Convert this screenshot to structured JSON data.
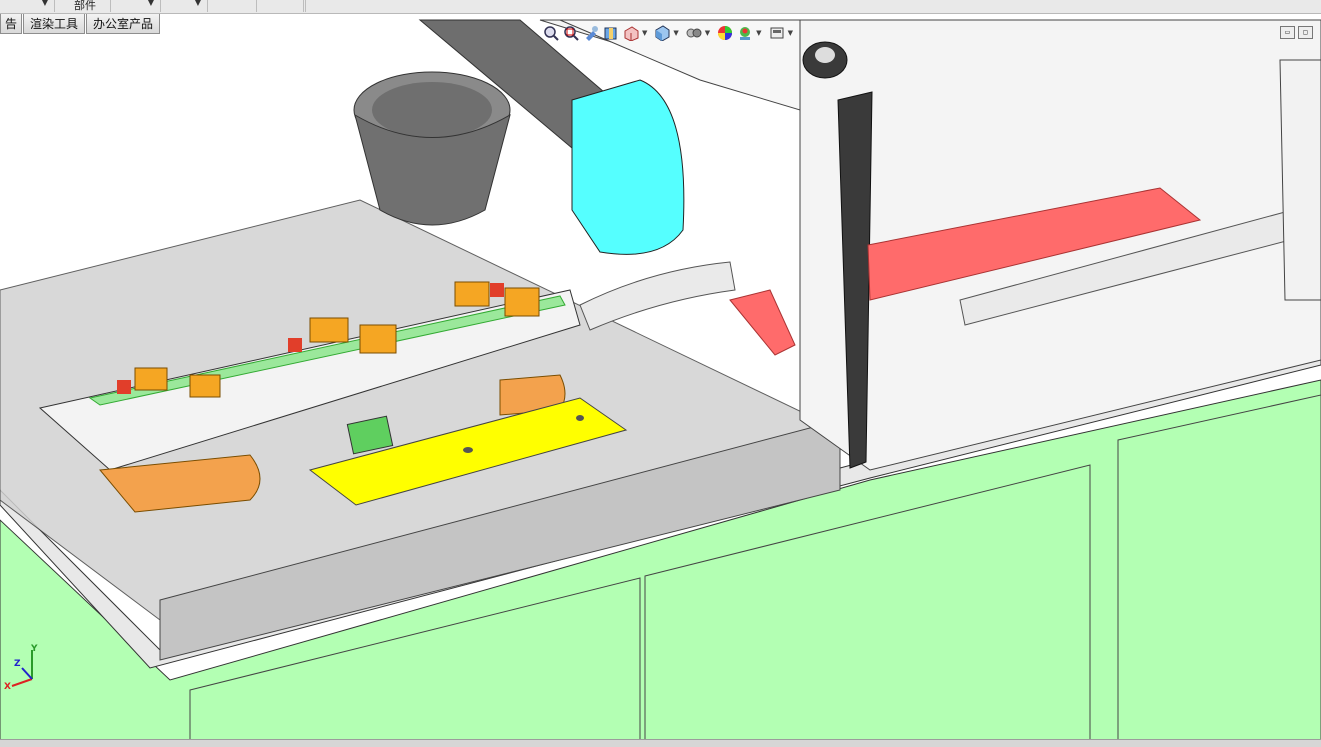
{
  "toolbar": {
    "dropdown1": "",
    "dropdown2_label": "部件",
    "dropdown3": ""
  },
  "tabs": [
    {
      "label": "告"
    },
    {
      "label": "渲染工具"
    },
    {
      "label": "办公室产品"
    }
  ],
  "heads_up_icons": [
    "zoom-to-fit-icon",
    "zoom-area-icon",
    "previous-view-icon",
    "section-view-icon",
    "dynamic-annotation-icon",
    "view-orientation-icon",
    "display-style-icon",
    "hide-show-items-icon",
    "edit-appearance-icon",
    "apply-scene-icon",
    "view-settings-icon"
  ],
  "triad": {
    "x": "X",
    "y": "Y",
    "z": "Z"
  },
  "colors": {
    "background_cabinet": "#b3ffb3",
    "cylinder": "#55ffff",
    "plate_yellow": "#ffff00",
    "rail_red": "#ff6b6b",
    "part_orange": "#f5a623"
  }
}
